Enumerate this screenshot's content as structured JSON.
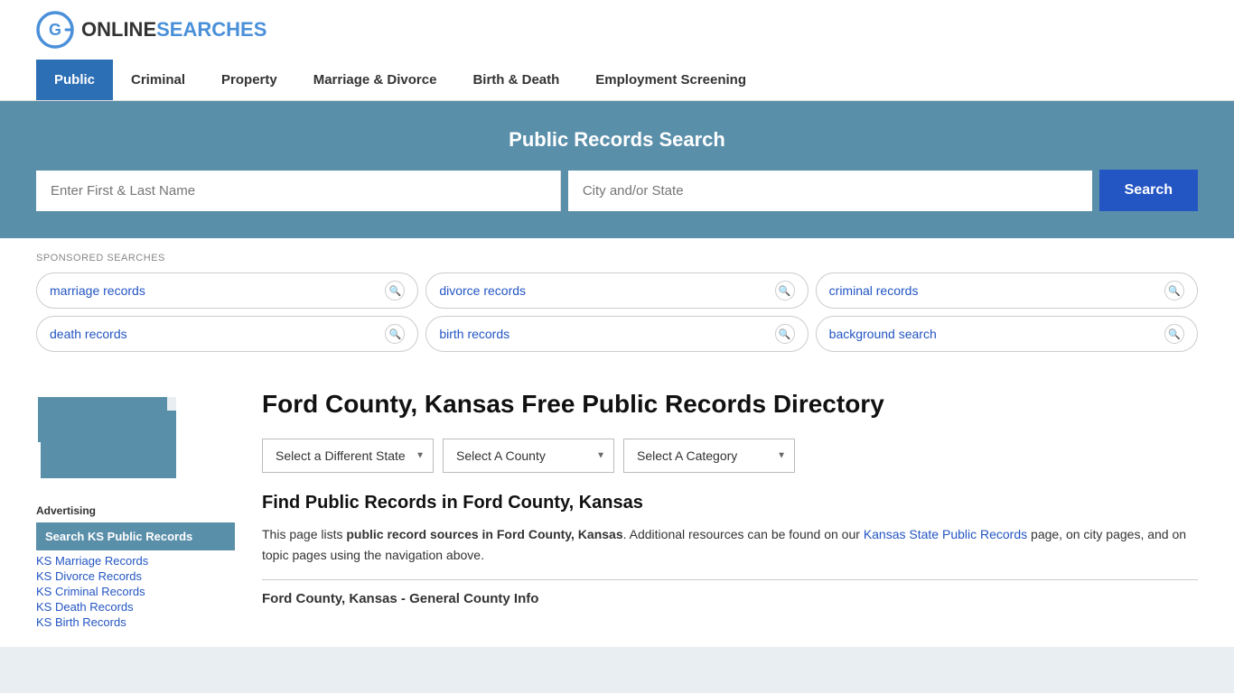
{
  "logo": {
    "online": "ONLINE",
    "searches": "SEARCHES"
  },
  "nav": {
    "items": [
      {
        "label": "Public",
        "active": true
      },
      {
        "label": "Criminal",
        "active": false
      },
      {
        "label": "Property",
        "active": false
      },
      {
        "label": "Marriage & Divorce",
        "active": false
      },
      {
        "label": "Birth & Death",
        "active": false
      },
      {
        "label": "Employment Screening",
        "active": false
      }
    ]
  },
  "search_banner": {
    "title": "Public Records Search",
    "name_placeholder": "Enter First & Last Name",
    "city_placeholder": "City and/or State",
    "search_button": "Search"
  },
  "sponsored": {
    "label": "SPONSORED SEARCHES",
    "tags": [
      "marriage records",
      "divorce records",
      "criminal records",
      "death records",
      "birth records",
      "background search"
    ]
  },
  "page": {
    "title": "Ford County, Kansas Free Public Records Directory",
    "state_label": "Select a Different State",
    "county_label": "Select A County",
    "category_label": "Select A Category",
    "find_title": "Find Public Records in Ford County, Kansas",
    "find_description_1": "This page lists ",
    "find_description_bold": "public record sources in Ford County, Kansas",
    "find_description_2": ". Additional resources can be found on our ",
    "find_description_link": "Kansas State Public Records",
    "find_description_3": " page, on city pages, and on topic pages using the navigation above.",
    "section_subtitle": "Ford County, Kansas - General County Info"
  },
  "sidebar": {
    "advertising_label": "Advertising",
    "ad_active_label": "Search KS Public Records",
    "links": [
      "KS Marriage Records",
      "KS Divorce Records",
      "KS Criminal Records",
      "KS Death Records",
      "KS Birth Records"
    ]
  }
}
